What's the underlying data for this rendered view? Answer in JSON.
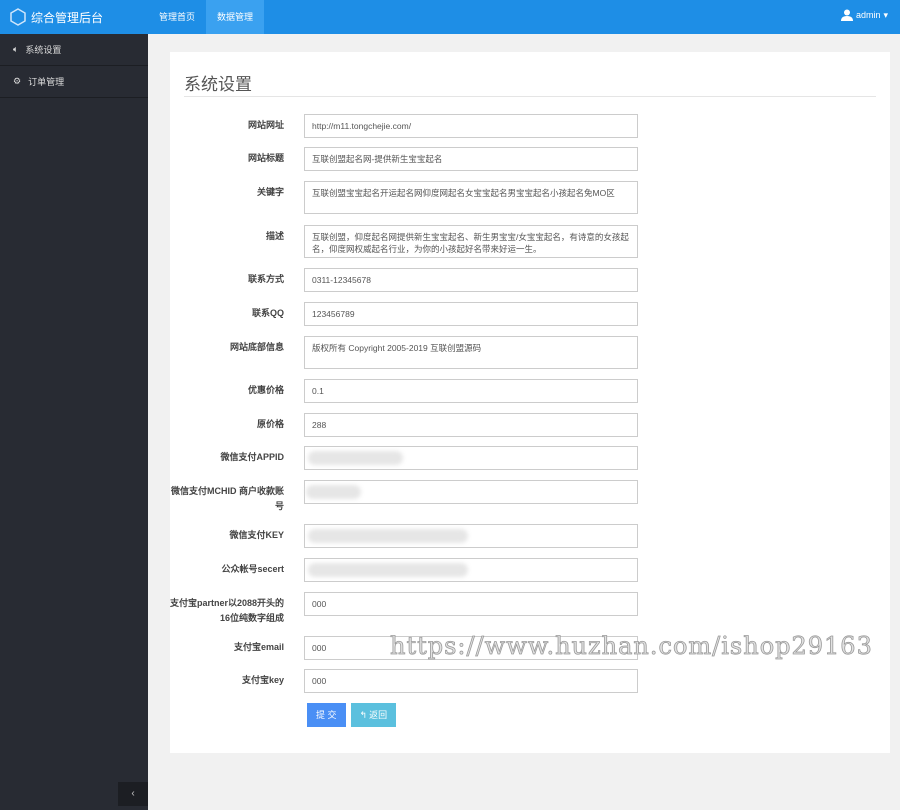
{
  "header": {
    "app_title": "综合管理后台",
    "nav": [
      "管理首页",
      "数据管理"
    ],
    "active_nav": 1,
    "user": "admin"
  },
  "sidebar": {
    "items": [
      "系统设置",
      "订单管理"
    ],
    "collapse_icon": "‹"
  },
  "main": {
    "title": "系统设置",
    "fields": [
      {
        "label": "网站网址",
        "value": "http://m11.tongchejie.com/"
      },
      {
        "label": "网站标题",
        "value": "互联创盟起名网-提供新生宝宝起名"
      },
      {
        "label": "关键字",
        "value": "互联创盟宝宝起名开运起名网仰度网起名女宝宝起名男宝宝起名小孩起名免MO区"
      },
      {
        "label": "描述",
        "value": "互联创盟，仰度起名网提供新生宝宝起名、新生男宝宝/女宝宝起名，有诗意的女孩起名，仰度网权威起名行业，为你的小孩起好名带来好运一生。"
      },
      {
        "label": "联系方式",
        "value": "0311-12345678"
      },
      {
        "label": "联系QQ",
        "value": "123456789"
      },
      {
        "label": "网站底部信息",
        "value": "版权所有 Copyright  2005-2019 互联创盟源码"
      },
      {
        "label": "优惠价格",
        "value": "0.1"
      },
      {
        "label": "原价格",
        "value": "288"
      },
      {
        "label": "微信支付APPID",
        "value": ""
      },
      {
        "label": "微信支付MCHID 商户收款账号",
        "value": ""
      },
      {
        "label": "微信支付KEY",
        "value": ""
      },
      {
        "label": "公众帐号secert",
        "value": ""
      },
      {
        "label": "支付宝partner以2088开头的16位纯数字组成",
        "value": "000"
      },
      {
        "label": "支付宝email",
        "value": "000"
      },
      {
        "label": "支付宝key",
        "value": "000"
      }
    ],
    "submit_label": "提 交",
    "back_label": "返回"
  },
  "watermark": "https://www.huzhan.com/ishop29163",
  "colors": {
    "topbar": "#1e8ee6",
    "sidebar": "#282b33",
    "submit": "#4a8ff5",
    "back": "#5bc0de"
  }
}
